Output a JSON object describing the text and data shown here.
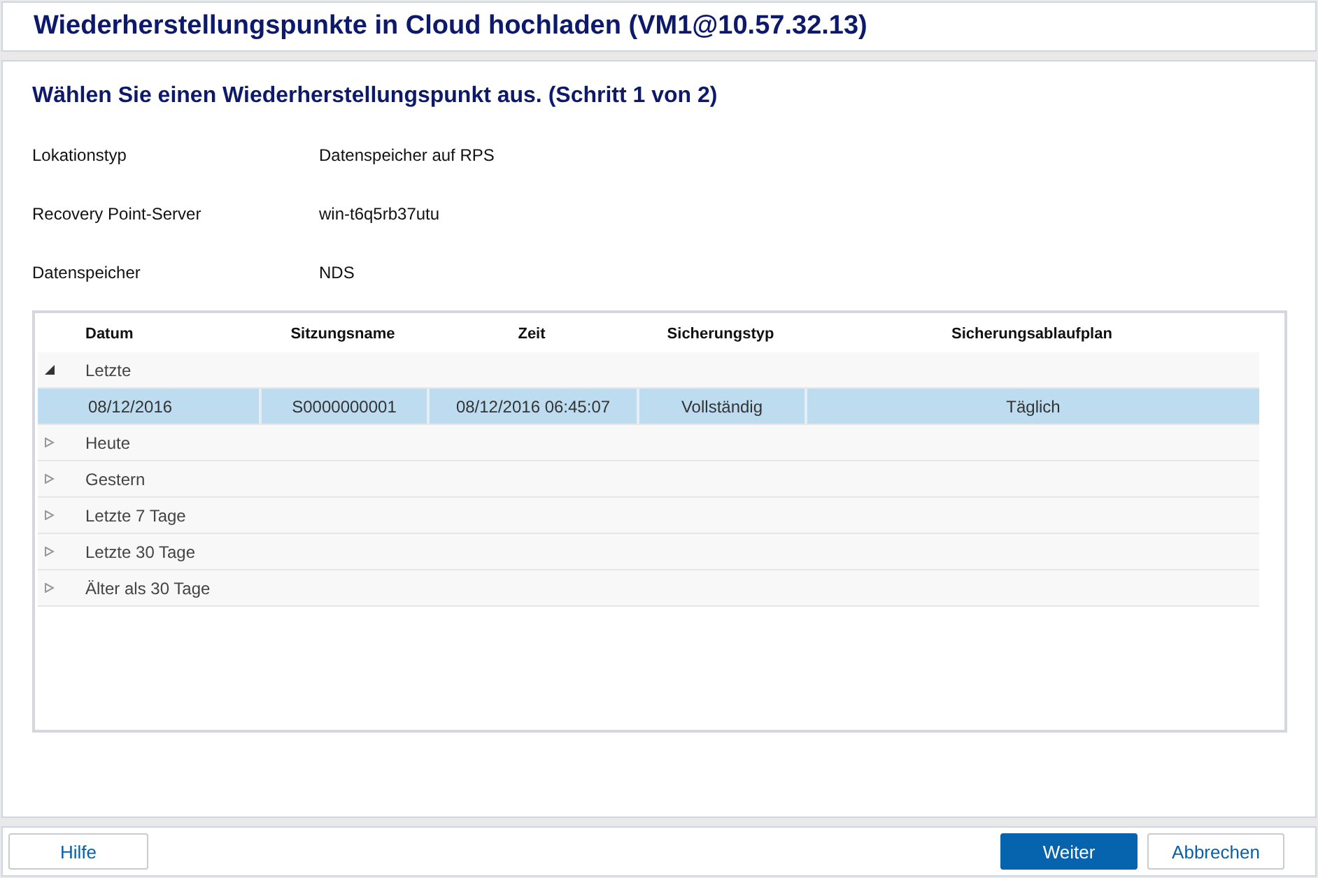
{
  "window": {
    "title": "Wiederherstellungspunkte in Cloud hochladen (VM1@10.57.32.13)"
  },
  "step_title": "Wählen Sie einen Wiederherstellungspunkt aus. (Schritt 1 von 2)",
  "fields": [
    {
      "label": "Lokationstyp",
      "value": "Datenspeicher auf RPS"
    },
    {
      "label": "Recovery Point-Server",
      "value": "win-t6q5rb37utu"
    },
    {
      "label": "Datenspeicher",
      "value": "NDS"
    }
  ],
  "table": {
    "columns": [
      "Datum",
      "Sitzungsname",
      "Zeit",
      "Sicherungstyp",
      "Sicherungsablaufplan"
    ],
    "groups": [
      {
        "label": "Letzte",
        "expanded": true,
        "rows": [
          {
            "cells": [
              "08/12/2016",
              "S0000000001",
              "08/12/2016 06:45:07",
              "Vollständig",
              "Täglich"
            ],
            "selected": true
          }
        ]
      },
      {
        "label": "Heute",
        "expanded": false
      },
      {
        "label": "Gestern",
        "expanded": false
      },
      {
        "label": "Letzte 7 Tage",
        "expanded": false
      },
      {
        "label": "Letzte 30 Tage",
        "expanded": false
      },
      {
        "label": "Älter als 30 Tage",
        "expanded": false
      }
    ]
  },
  "buttons": [
    {
      "label": "Hilfe",
      "kind": "secondary"
    },
    {
      "label": "Weiter",
      "kind": "primary"
    },
    {
      "label": "Abbrechen",
      "kind": "secondary"
    }
  ]
}
